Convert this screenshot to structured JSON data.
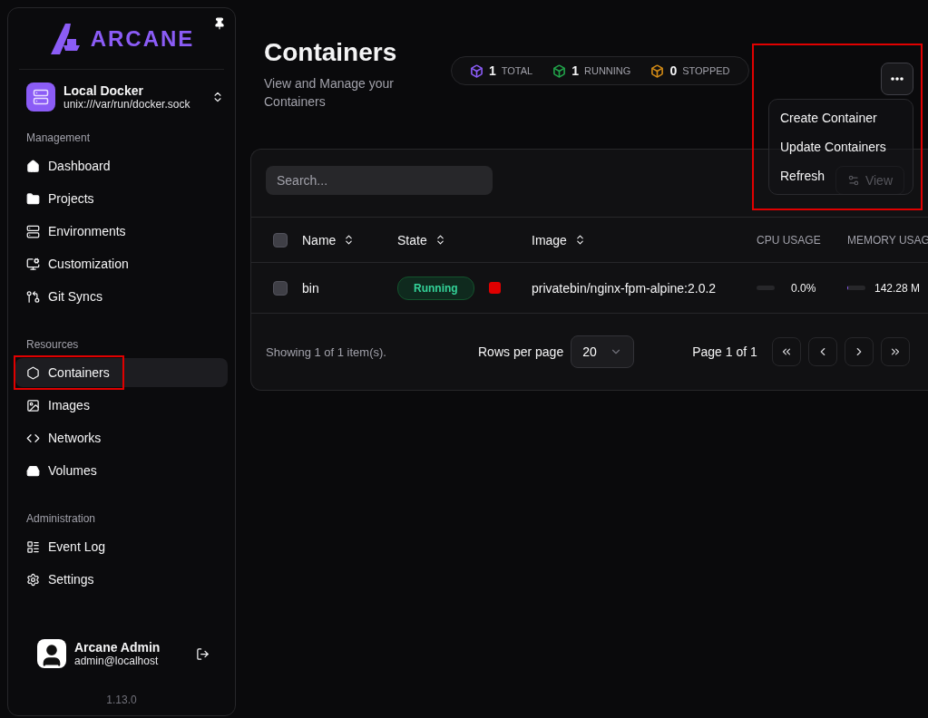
{
  "sidebar": {
    "logo": "ARCANE",
    "environment": {
      "name": "Local Docker",
      "address": "unix:///var/run/docker.sock"
    },
    "groups": [
      {
        "title": "Management",
        "items": [
          {
            "label": "Dashboard",
            "selected": false,
            "highlighted": false
          },
          {
            "label": "Projects",
            "selected": false,
            "highlighted": false
          },
          {
            "label": "Environments",
            "selected": false,
            "highlighted": false
          },
          {
            "label": "Customization",
            "selected": false,
            "highlighted": false
          },
          {
            "label": "Git Syncs",
            "selected": false,
            "highlighted": false
          }
        ]
      },
      {
        "title": "Resources",
        "items": [
          {
            "label": "Containers",
            "selected": true,
            "highlighted": true
          },
          {
            "label": "Images",
            "selected": false,
            "highlighted": false
          },
          {
            "label": "Networks",
            "selected": false,
            "highlighted": false
          },
          {
            "label": "Volumes",
            "selected": false,
            "highlighted": false
          }
        ]
      },
      {
        "title": "Administration",
        "items": [
          {
            "label": "Event Log",
            "selected": false,
            "highlighted": false
          },
          {
            "label": "Settings",
            "selected": false,
            "highlighted": false
          }
        ]
      }
    ],
    "user": {
      "name": "Arcane Admin",
      "email": "admin@localhost"
    },
    "version": "1.13.0"
  },
  "header": {
    "title": "Containers",
    "subtitle": "View and Manage your Containers",
    "stats": [
      {
        "value": "1",
        "label": "TOTAL",
        "color": "#8b5cf6"
      },
      {
        "value": "1",
        "label": "RUNNING",
        "color": "#22a34a"
      },
      {
        "value": "0",
        "label": "STOPPED",
        "color": "#d18a16"
      }
    ]
  },
  "actions_menu": {
    "expanded": true,
    "highlighted": true,
    "items": [
      "Create Container",
      "Update Containers",
      "Refresh"
    ]
  },
  "table": {
    "search": {
      "placeholder": "Search..."
    },
    "view_button": "View",
    "select_all": {
      "checked": false
    },
    "columns": [
      {
        "label": "Name",
        "sortable": true
      },
      {
        "label": "State",
        "sortable": true
      },
      {
        "label": "Image",
        "sortable": true
      },
      {
        "label": "CPU USAGE",
        "sortable": false
      },
      {
        "label": "MEMORY USAG",
        "sortable": false
      }
    ],
    "rows": [
      {
        "checked": false,
        "name": "bin",
        "state": "Running",
        "image": "privatebin/nginx-fpm-alpine:2.0.2",
        "cpu": {
          "level": 0,
          "reading": "0.0%"
        },
        "memory": {
          "level": 0.05,
          "reading": "142.28 M"
        }
      }
    ],
    "footer": {
      "summary": "Showing 1 of 1 item(s).",
      "rows_per_page_label": "Rows per page",
      "rows_per_page": "20",
      "page": "Page 1 of 1"
    }
  }
}
